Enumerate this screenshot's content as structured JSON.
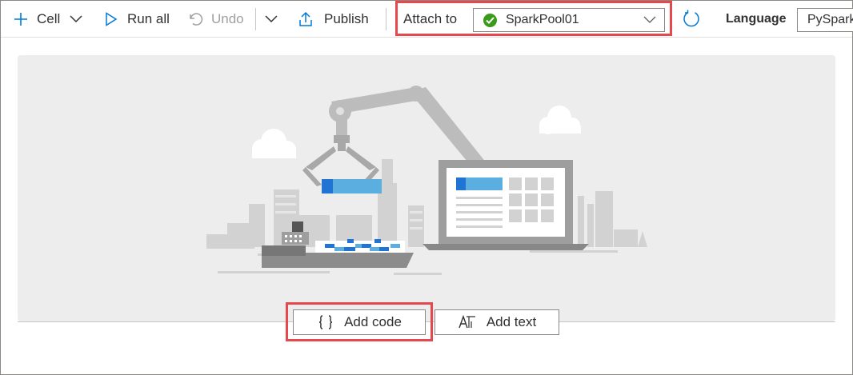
{
  "toolbar": {
    "cell_label": "Cell",
    "run_all_label": "Run all",
    "undo_label": "Undo",
    "publish_label": "Publish",
    "attach_to_label": "Attach to",
    "pool_value": "SparkPool01",
    "pool_status_color": "#3a9a1b",
    "language_label": "Language",
    "language_value": "PySpark"
  },
  "actions": {
    "add_code_label": "Add code",
    "add_text_label": "Add text"
  },
  "colors": {
    "accent": "#0078d4",
    "highlight": "#e5484d",
    "panel_bg": "#ededed"
  },
  "icons": [
    "plus-icon",
    "chevron-down-icon",
    "play-icon",
    "undo-icon",
    "publish-icon",
    "check-circle-icon",
    "refresh-icon",
    "braces-icon",
    "text-icon"
  ]
}
